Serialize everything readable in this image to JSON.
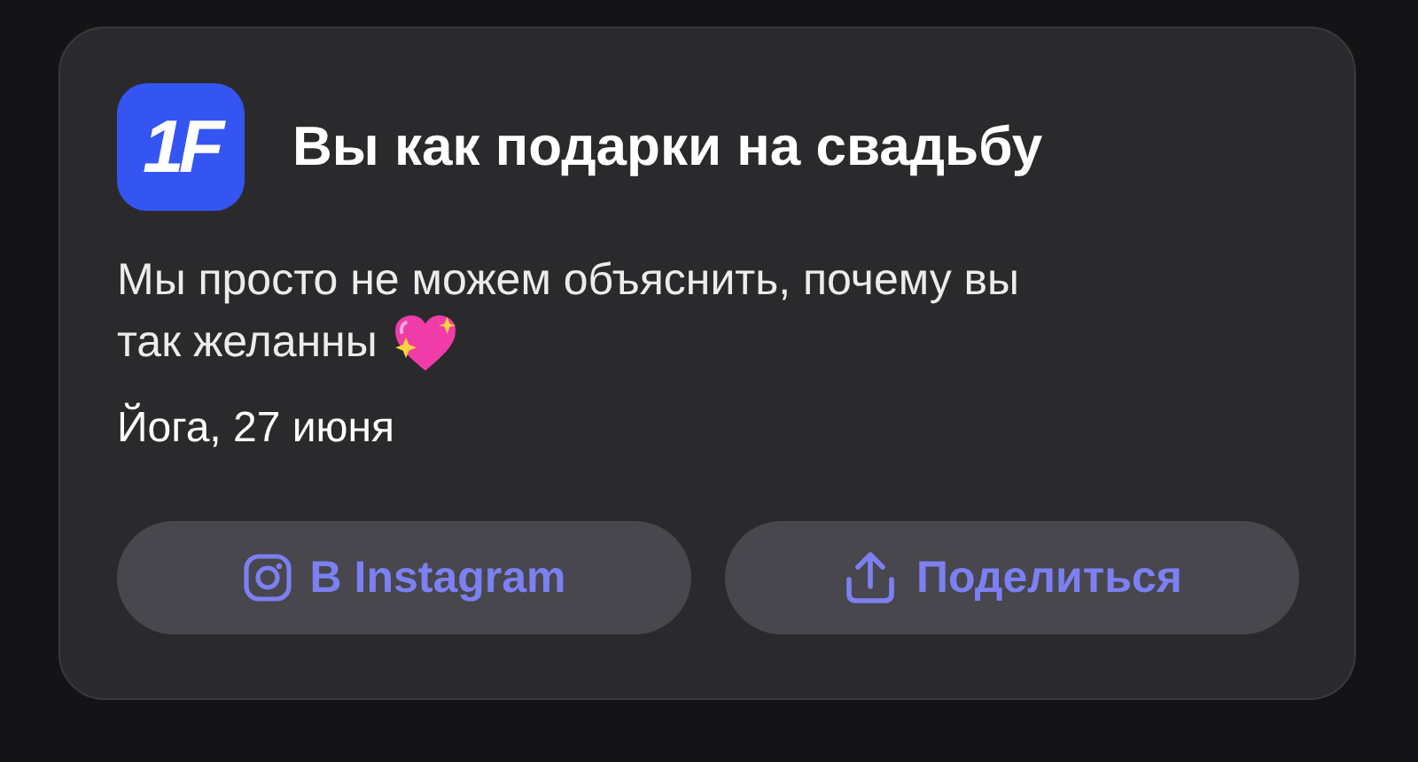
{
  "notification": {
    "app_logo": "1F",
    "title": "Вы как подарки на свадьбу",
    "message_lines": [
      "Мы просто не можем объяснить, почему вы",
      "так желанны"
    ],
    "meta": "Йога, 27 июня"
  },
  "buttons": [
    {
      "kind": "instagram",
      "label": "В Instagram"
    },
    {
      "kind": "share",
      "label": "Поделиться"
    }
  ]
}
